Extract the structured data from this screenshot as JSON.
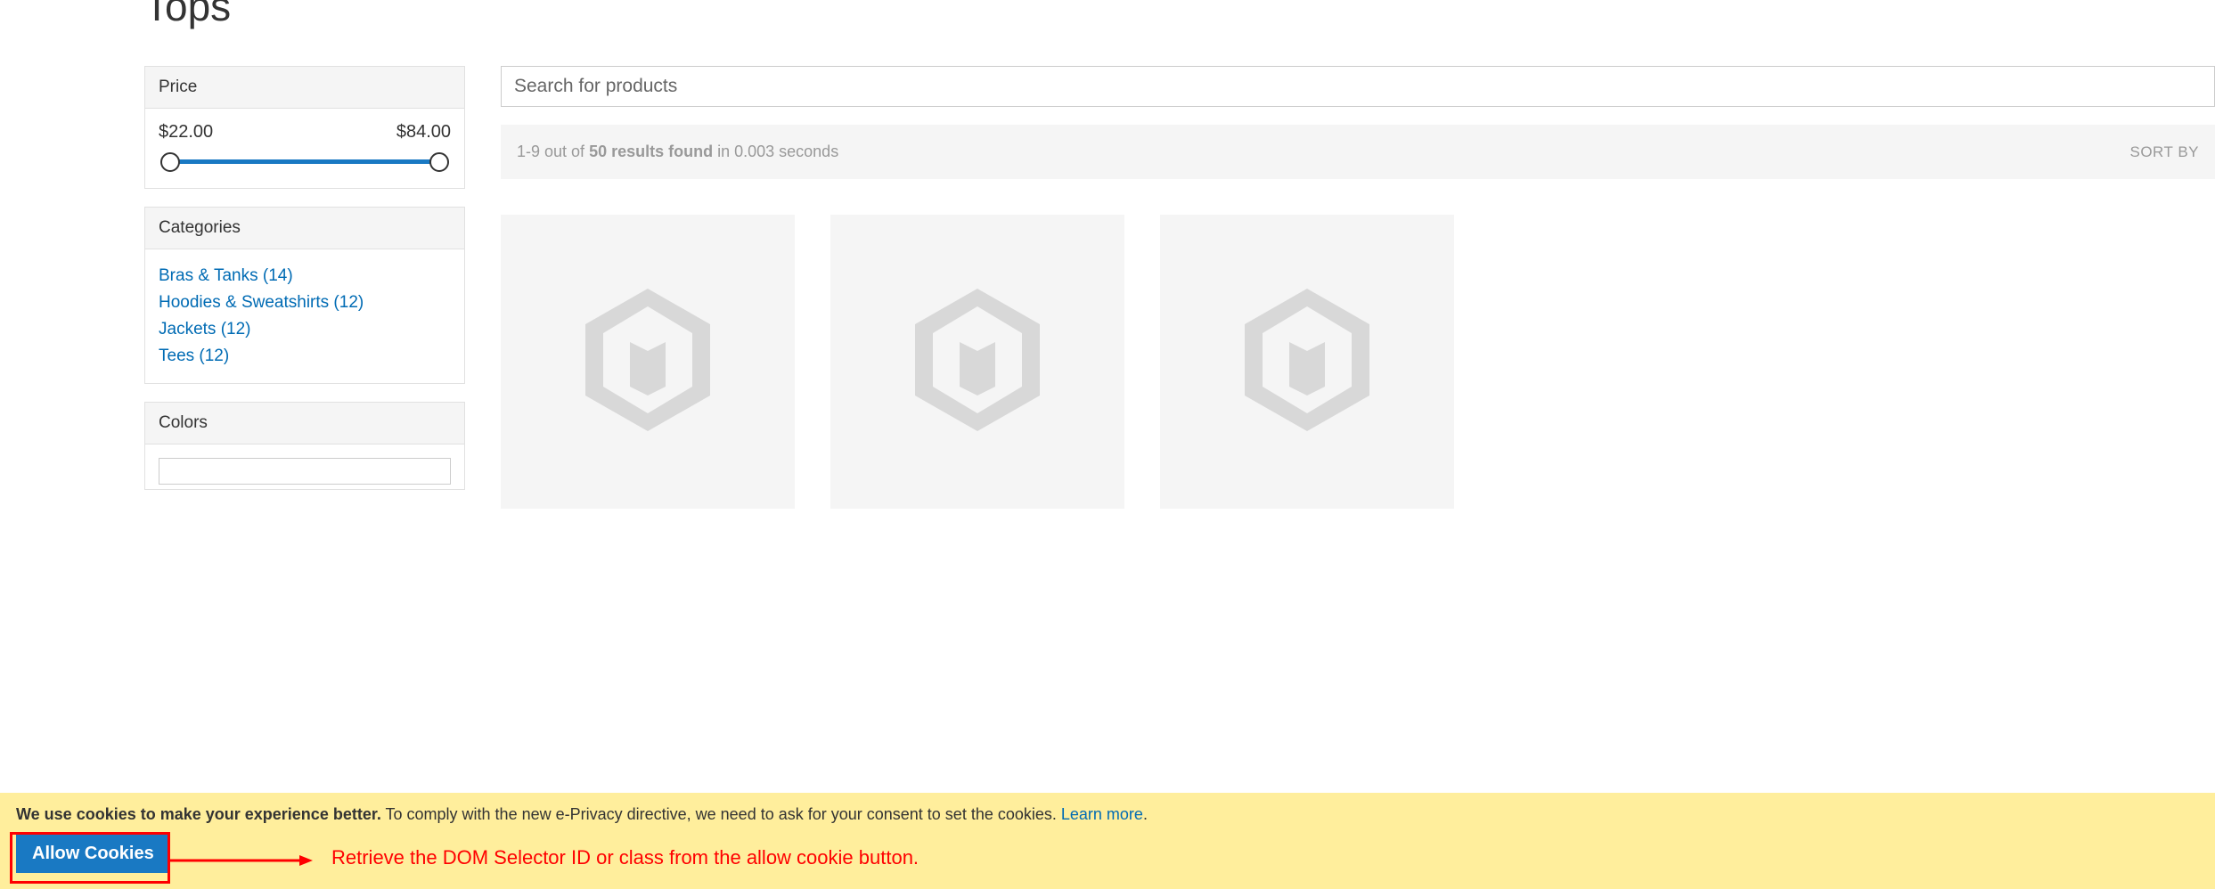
{
  "page": {
    "title": "Tops"
  },
  "filters": {
    "price": {
      "header": "Price",
      "min_label": "$22.00",
      "max_label": "$84.00"
    },
    "categories": {
      "header": "Categories",
      "items": [
        {
          "label": "Bras & Tanks (14)"
        },
        {
          "label": "Hoodies & Sweatshirts (12)"
        },
        {
          "label": "Jackets (12)"
        },
        {
          "label": "Tees (12)"
        }
      ]
    },
    "colors": {
      "header": "Colors"
    }
  },
  "search": {
    "placeholder": "Search for products"
  },
  "results": {
    "prefix": "1-9 out of ",
    "count": "50 results found",
    "suffix": " in 0.003 seconds",
    "sort_label": "SORT BY"
  },
  "cookie_banner": {
    "bold_text": "We use cookies to make your experience better.",
    "text": " To comply with the new e-Privacy directive, we need to ask for your consent to set the cookies. ",
    "link": "Learn more",
    "period": ".",
    "button": "Allow Cookies"
  },
  "annotation": {
    "text": "Retrieve the DOM Selector ID or class from the allow cookie button."
  }
}
